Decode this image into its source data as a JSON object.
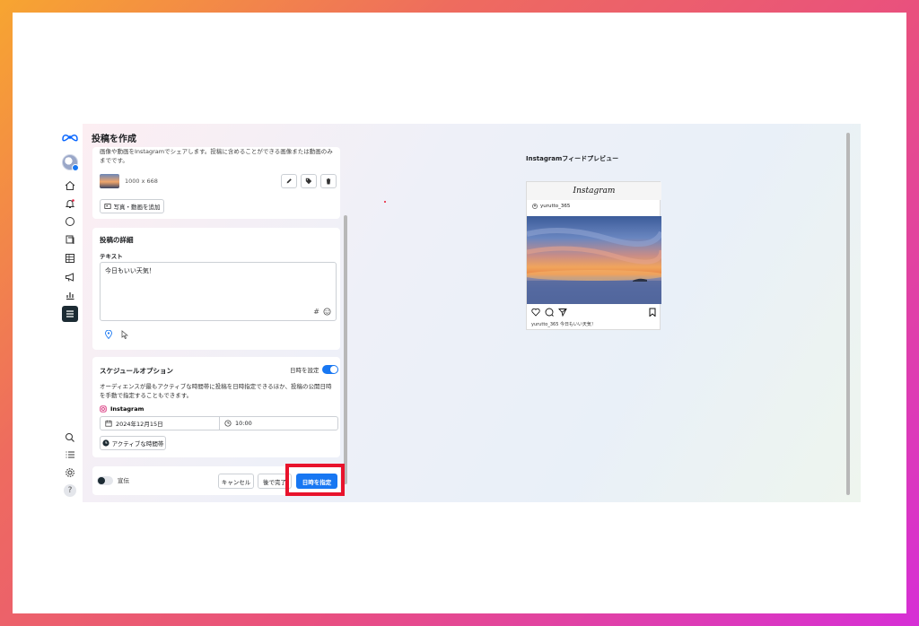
{
  "header": {
    "title": "投稿を作成"
  },
  "rail": {
    "icons": [
      "meta-logo",
      "avatar",
      "home-icon",
      "bell-icon",
      "chat-icon",
      "pages-icon",
      "table-icon",
      "megaphone-icon",
      "chart-icon",
      "menu-icon",
      "search-icon",
      "list-icon",
      "gear-icon",
      "help-icon"
    ],
    "help_label": "?"
  },
  "media": {
    "faded_text": "画像や動画をInstagramでシェアします。投稿に含めることができる画像または動画のみ\nまでです。",
    "dimensions": "1000 x 668",
    "add_button": "写真・動画を追加"
  },
  "details": {
    "title": "投稿の詳細",
    "text_label": "テキスト",
    "text_value": "今日もいい天気！",
    "hash_symbol": "#"
  },
  "schedule": {
    "title": "スケジュールオプション",
    "toggle_label": "日時を設定",
    "description": "オーディエンスが最もアクティブな時間帯に投稿を日時指定できるほか、投稿の公開日時を手動で指定することもできます。",
    "platform": "Instagram",
    "date": "2024年12月15日",
    "time": "10:00",
    "active_times_button": "アクティブな時間帯"
  },
  "footer": {
    "boost_label": "宣伝",
    "cancel": "キャンセル",
    "finish_later": "後で完了",
    "schedule": "日時を指定"
  },
  "preview": {
    "title": "Instagramフィードプレビュー",
    "brand": "Instagram",
    "username": "yurutto_365",
    "caption": "yurutto_365 今日もいい天気！"
  },
  "colors": {
    "accent": "#1877f2",
    "highlight": "#e8132c"
  }
}
